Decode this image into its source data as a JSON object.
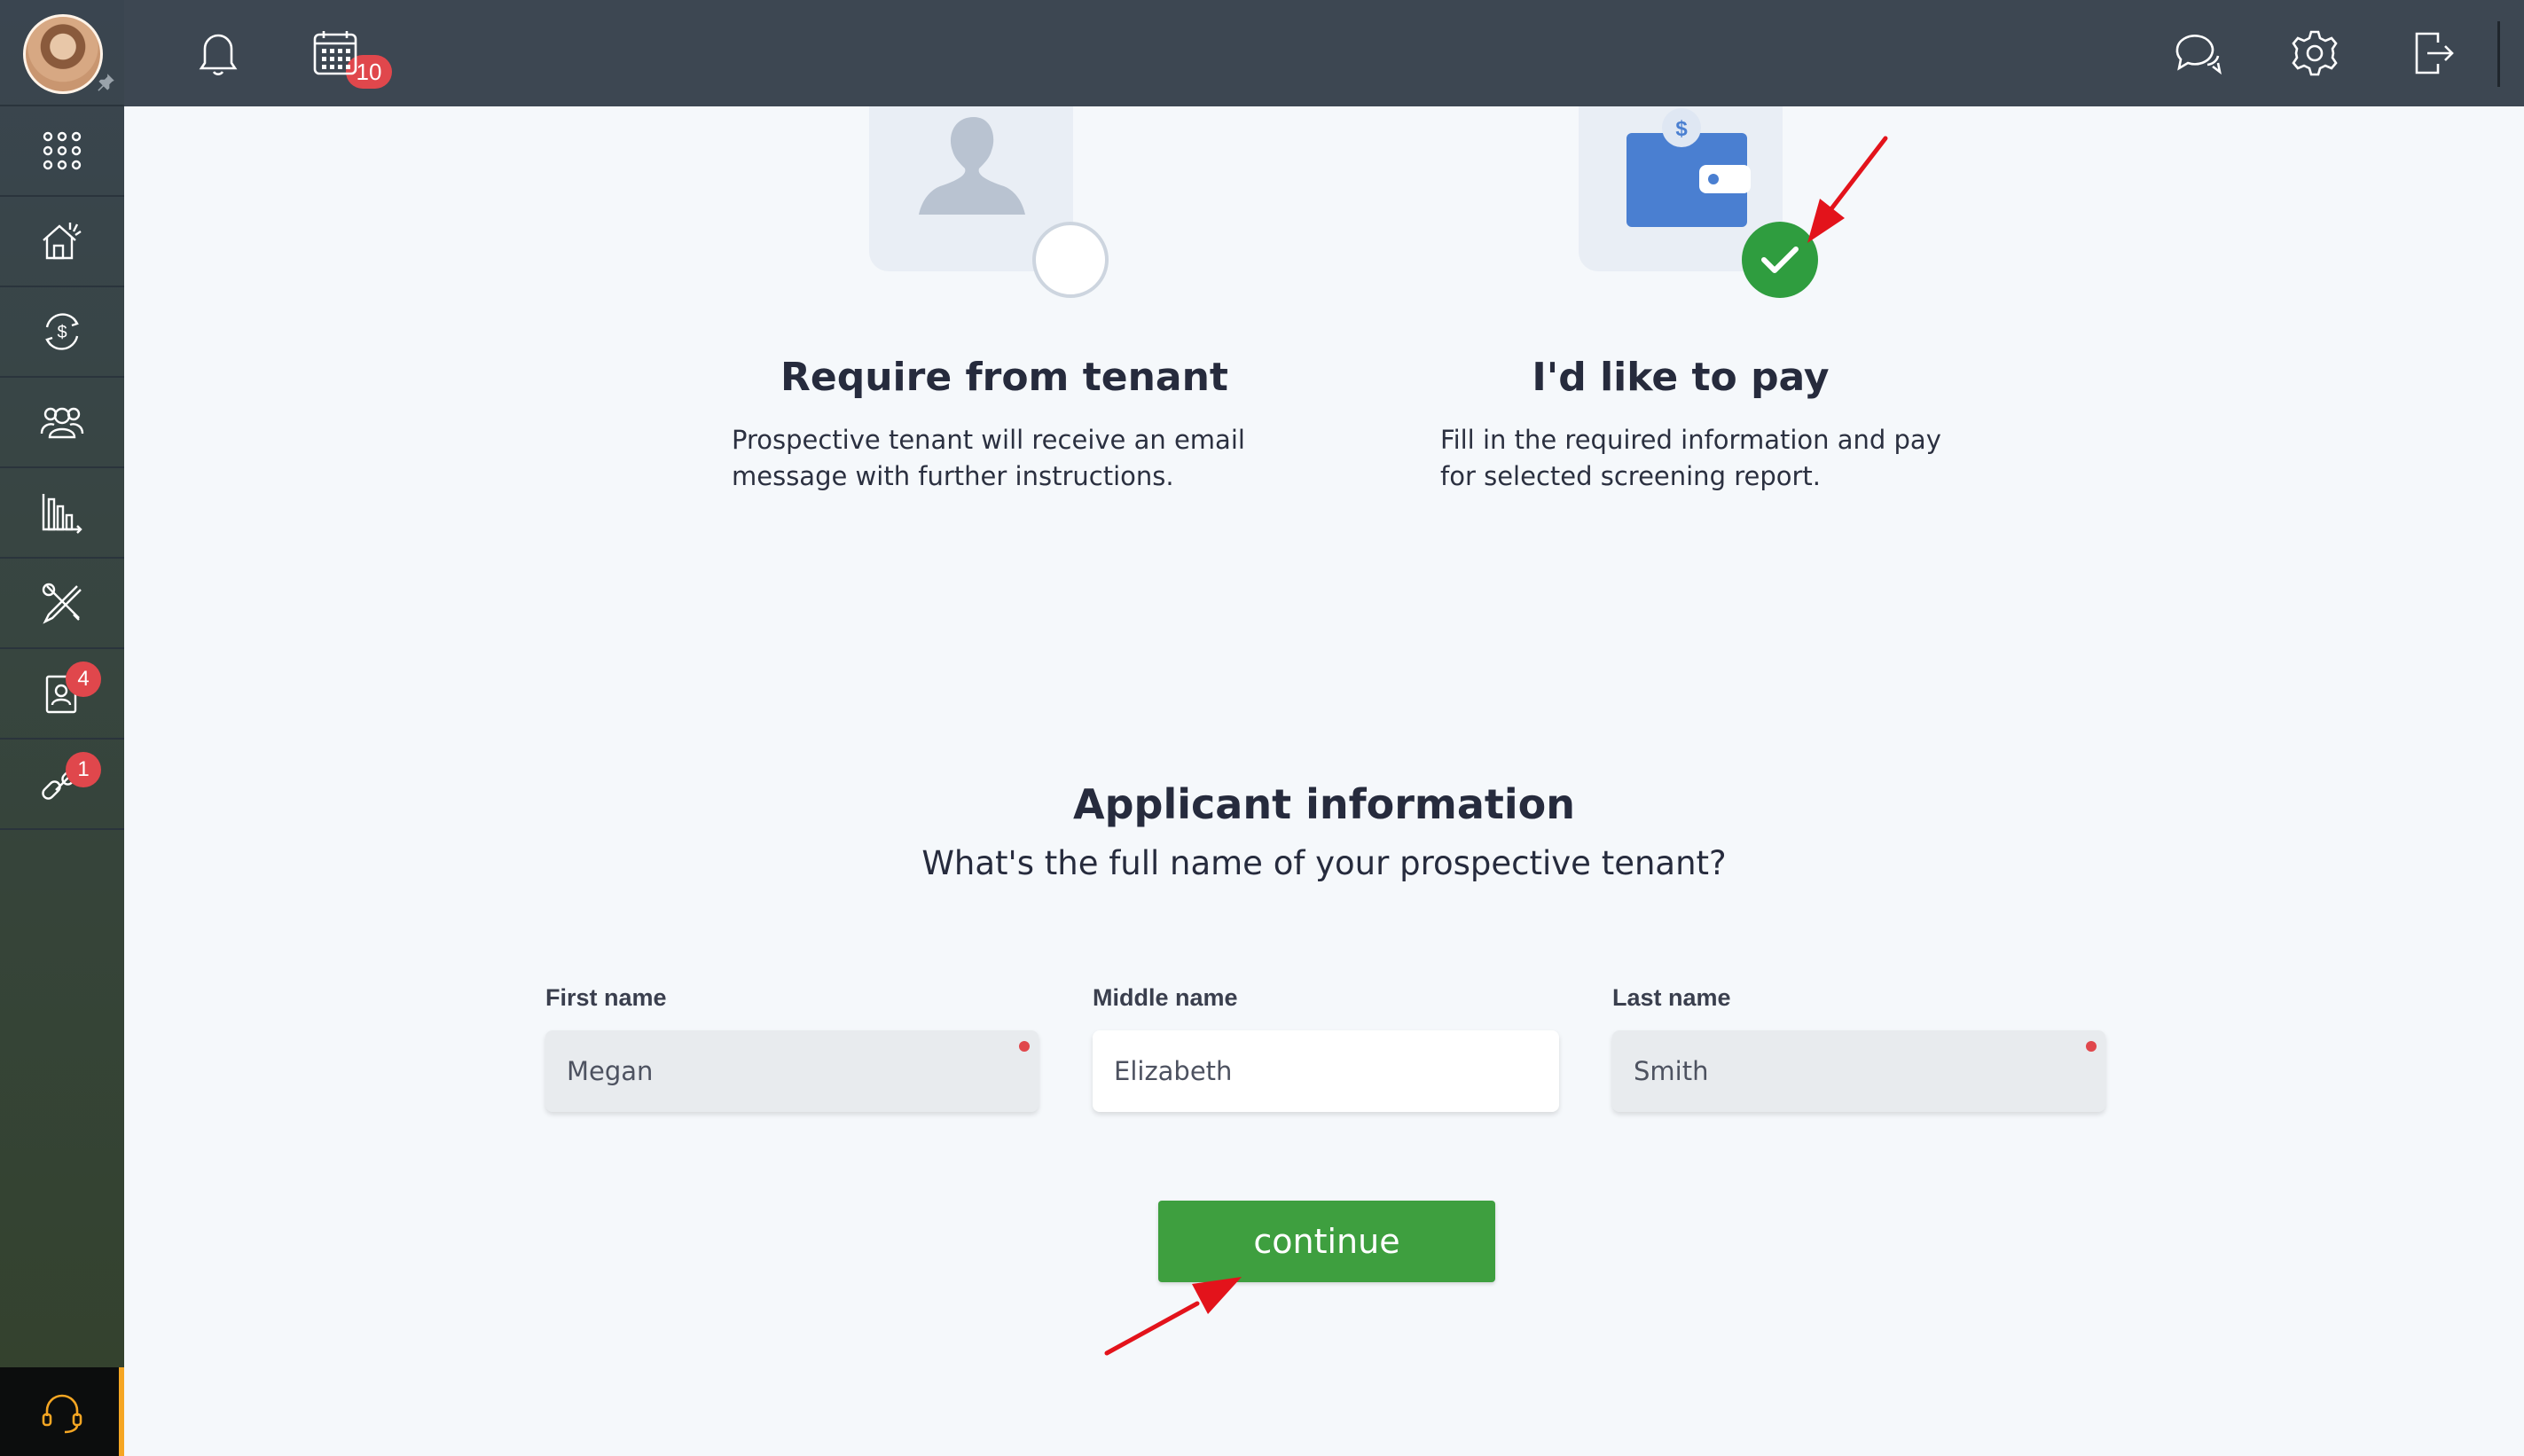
{
  "topbar": {
    "notifications_count": "10",
    "icons": [
      "bell-icon",
      "calendar-icon",
      "chat-icon",
      "settings-icon",
      "logout-icon"
    ]
  },
  "sidebar": {
    "items": [
      {
        "name": "apps-grid-icon"
      },
      {
        "name": "properties-icon"
      },
      {
        "name": "accounting-icon"
      },
      {
        "name": "tenants-icon"
      },
      {
        "name": "reports-icon"
      },
      {
        "name": "maintenance-icon"
      },
      {
        "name": "applicants-icon",
        "badge": "4"
      },
      {
        "name": "integrations-icon",
        "badge": "1"
      }
    ],
    "support_icon": "headset-icon"
  },
  "options": [
    {
      "title": "Require from tenant",
      "description_lines": [
        "Prospective tenant will receive an email",
        "message with further instructions."
      ],
      "selected": false
    },
    {
      "title": "I'd like to pay",
      "description_lines": [
        "Fill in the required information and pay",
        "for selected screening report."
      ],
      "selected": true,
      "wallet_symbol": "$"
    }
  ],
  "applicant": {
    "title": "Applicant information",
    "subtitle": "What's the full name of your prospective tenant?",
    "fields": [
      {
        "label": "First name",
        "value": "Megan",
        "required": true
      },
      {
        "label": "Middle name",
        "value": "Elizabeth",
        "required": false
      },
      {
        "label": "Last name",
        "value": "Smith",
        "required": true
      }
    ],
    "continue_label": "continue"
  },
  "colors": {
    "primary_green": "#3e9f3f",
    "badge_red": "#e0474c",
    "topbar": "#3d4752",
    "annotation_arrow": "#e3131b"
  }
}
